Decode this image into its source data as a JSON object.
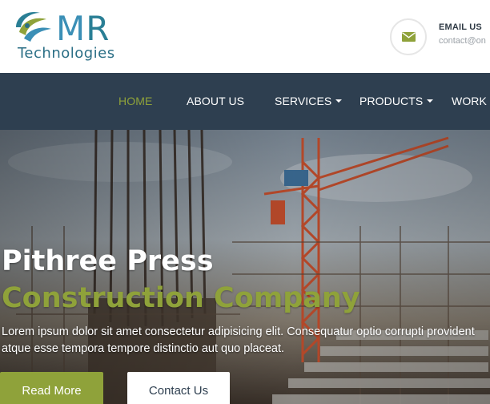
{
  "brand": {
    "logo_letters_m": "M",
    "logo_letters_r": "R",
    "logo_subtitle": "Technologies"
  },
  "contact": {
    "email_title": "EMAIL US",
    "email_address": "contact@on",
    "icon": "envelope-icon"
  },
  "nav": {
    "items": [
      {
        "label": "HOME",
        "active": true
      },
      {
        "label": "ABOUT US",
        "active": false
      },
      {
        "label": "SERVICES",
        "dropdown": true
      },
      {
        "label": "PRODUCTS",
        "dropdown": true
      },
      {
        "label": "WORK",
        "active": false
      }
    ]
  },
  "hero": {
    "title_line1": "Pithree Press",
    "title_line2": "Construction Company",
    "description": "Lorem ipsum dolor sit amet consectetur adipisicing elit. Consequatur optio corrupti provident atque esse tempora tempore distinctio aut quo placeat.",
    "primary_button": "Read More",
    "secondary_button": "Contact Us"
  },
  "colors": {
    "accent": "#8fa23a",
    "nav_background": "#2e3f50",
    "text_dark": "#2f3a45"
  }
}
